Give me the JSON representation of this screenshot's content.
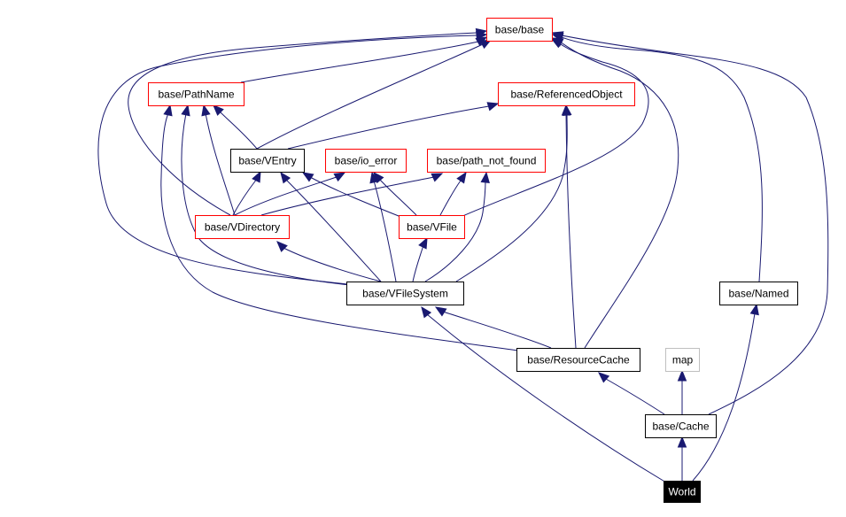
{
  "diagram": {
    "type": "inheritance-graph",
    "colors": {
      "edge": "#191970",
      "documented_border": "#000000",
      "undocumented_border": "#ff0000",
      "external_border": "#bfbfbf",
      "focus_fill": "#000000",
      "focus_text": "#ffffff"
    },
    "nodes": [
      {
        "id": "base_base",
        "label": "base/base",
        "style": "undocumented"
      },
      {
        "id": "pathname",
        "label": "base/PathName",
        "style": "undocumented"
      },
      {
        "id": "refobj",
        "label": "base/ReferencedObject",
        "style": "undocumented"
      },
      {
        "id": "ventry",
        "label": "base/VEntry",
        "style": "documented"
      },
      {
        "id": "ioerror",
        "label": "base/io_error",
        "style": "undocumented"
      },
      {
        "id": "pnf",
        "label": "base/path_not_found",
        "style": "undocumented"
      },
      {
        "id": "vdir",
        "label": "base/VDirectory",
        "style": "undocumented"
      },
      {
        "id": "vfile",
        "label": "base/VFile",
        "style": "undocumented"
      },
      {
        "id": "vfs",
        "label": "base/VFileSystem",
        "style": "documented"
      },
      {
        "id": "named",
        "label": "base/Named",
        "style": "documented"
      },
      {
        "id": "rescache",
        "label": "base/ResourceCache",
        "style": "documented"
      },
      {
        "id": "map",
        "label": "map",
        "style": "external"
      },
      {
        "id": "cache",
        "label": "base/Cache",
        "style": "documented"
      },
      {
        "id": "world",
        "label": "World",
        "style": "focus"
      }
    ],
    "edges": [
      {
        "from": "pathname",
        "to": "base_base"
      },
      {
        "from": "refobj",
        "to": "base_base"
      },
      {
        "from": "ventry",
        "to": "base_base"
      },
      {
        "from": "vdir",
        "to": "base_base"
      },
      {
        "from": "vfs",
        "to": "base_base"
      },
      {
        "from": "vfile",
        "to": "base_base"
      },
      {
        "from": "rescache",
        "to": "base_base"
      },
      {
        "from": "named",
        "to": "base_base"
      },
      {
        "from": "cache",
        "to": "base_base"
      },
      {
        "from": "ventry",
        "to": "pathname"
      },
      {
        "from": "vdir",
        "to": "pathname"
      },
      {
        "from": "vfs",
        "to": "pathname"
      },
      {
        "from": "rescache",
        "to": "pathname"
      },
      {
        "from": "ventry",
        "to": "refobj"
      },
      {
        "from": "rescache",
        "to": "refobj"
      },
      {
        "from": "vfs",
        "to": "refobj"
      },
      {
        "from": "vdir",
        "to": "ventry"
      },
      {
        "from": "vfile",
        "to": "ventry"
      },
      {
        "from": "vfs",
        "to": "ventry"
      },
      {
        "from": "vdir",
        "to": "ioerror"
      },
      {
        "from": "vfile",
        "to": "ioerror"
      },
      {
        "from": "vfs",
        "to": "ioerror"
      },
      {
        "from": "vdir",
        "to": "pnf"
      },
      {
        "from": "vfile",
        "to": "pnf"
      },
      {
        "from": "vfs",
        "to": "pnf"
      },
      {
        "from": "vfs",
        "to": "vdir"
      },
      {
        "from": "vfs",
        "to": "vfile"
      },
      {
        "from": "rescache",
        "to": "vfs"
      },
      {
        "from": "world",
        "to": "vfs"
      },
      {
        "from": "cache",
        "to": "rescache"
      },
      {
        "from": "cache",
        "to": "map"
      },
      {
        "from": "world",
        "to": "cache"
      },
      {
        "from": "world",
        "to": "named"
      }
    ]
  }
}
